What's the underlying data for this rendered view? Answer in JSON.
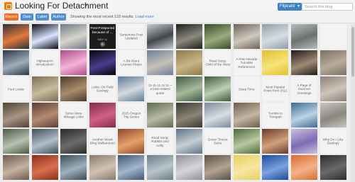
{
  "header": {
    "blog_title": "Looking For Detachment",
    "view_label": "Flipcard",
    "search_placeholder": "Search this blog"
  },
  "subbar": {
    "tabs": [
      "Recent",
      "Date",
      "Label",
      "Author"
    ],
    "showing_text": "Showing the most recent 110 results.",
    "load_more": "Load more"
  },
  "featured": {
    "title": "Post Postponed because of ...",
    "date": "MAY 11",
    "count": "0"
  },
  "grid": [
    [
      {
        "type": "img",
        "colors": [
          "#2c3038",
          "#e27a3b"
        ]
      },
      {
        "type": "img",
        "colors": [
          "#0d0d14",
          "#d9e4ff"
        ]
      },
      {
        "type": "img",
        "colors": [
          "#6f7a85",
          "#d8d4cb"
        ]
      },
      {
        "type": "featured"
      },
      {
        "type": "text",
        "caption": "Serpentine Post Updated"
      },
      {
        "type": "img",
        "colors": [
          "#c9ccd0",
          "#414649"
        ]
      },
      {
        "type": "img",
        "colors": [
          "#1e1f1c",
          "#8c8a7d"
        ]
      },
      {
        "type": "img",
        "colors": [
          "#3a4a2a",
          "#9aab7b"
        ]
      },
      {
        "type": "img",
        "colors": [
          "#6c6357",
          "#cfc9bd"
        ]
      },
      {
        "type": "img",
        "colors": [
          "#8d9faa",
          "#d7dde0"
        ]
      },
      {
        "type": "img",
        "colors": [
          "#b8bdbf",
          "#6a7270"
        ]
      },
      {
        "type": "text",
        "caption": ""
      }
    ],
    [
      {
        "type": "img",
        "colors": [
          "#2a3642",
          "#a0aebc"
        ]
      },
      {
        "type": "text",
        "caption": "Highway4A Introduction!"
      },
      {
        "type": "img",
        "colors": [
          "#b04a86",
          "#f3b4d9"
        ]
      },
      {
        "type": "img",
        "colors": [
          "#050505",
          "#4a3c8e"
        ]
      },
      {
        "type": "text",
        "caption": "A Bit About License Plates"
      },
      {
        "type": "img",
        "colors": [
          "#6d7e9b",
          "#c7c2b6"
        ]
      },
      {
        "type": "img",
        "colors": [
          "#8f7a45",
          "#c7b58a"
        ]
      },
      {
        "type": "text",
        "caption": "Road Song: Child of the West"
      },
      {
        "type": "text",
        "caption": "A Few Nevada Turnstile References"
      },
      {
        "type": "img",
        "colors": [
          "#e2c12a",
          "#f6e37b"
        ]
      },
      {
        "type": "img",
        "colors": [
          "#1f1a16",
          "#9f8a74"
        ]
      },
      {
        "type": "img",
        "colors": [
          "#7c7064",
          "#b8ab9c"
        ]
      }
    ],
    [
      {
        "type": "text",
        "caption": "Foot Loose"
      },
      {
        "type": "img",
        "colors": [
          "#7a6e55",
          "#c8bc9f"
        ]
      },
      {
        "type": "img",
        "colors": [
          "#4b3b2a",
          "#a98d6c"
        ]
      },
      {
        "type": "text",
        "caption": "Links: On Field Geology"
      },
      {
        "type": "img",
        "colors": [
          "#5c7a99",
          "#d4d9de"
        ]
      },
      {
        "type": "text",
        "caption": "11-11-11 11:11 ~ a time-related quote"
      },
      {
        "type": "img",
        "colors": [
          "#3e5a46",
          "#a8b89a"
        ]
      },
      {
        "type": "img",
        "colors": [
          "#3d5b3a",
          "#bfcfb3"
        ]
      },
      {
        "type": "text",
        "caption": "Deep Time"
      },
      {
        "type": "text",
        "caption": "Most Popular Posts from 2011"
      },
      {
        "type": "text",
        "caption": "A Page of Summer Greetings"
      },
      {
        "type": "img",
        "colors": [
          "#8b8179",
          "#cfc4b8"
        ]
      }
    ],
    [
      {
        "type": "img",
        "colors": [
          "#4e4237",
          "#a99482"
        ]
      },
      {
        "type": "img",
        "colors": [
          "#5a3d33",
          "#b48b71"
        ]
      },
      {
        "type": "text",
        "caption": "Some More Mileage Links"
      },
      {
        "type": "img",
        "colors": [
          "#7d2d47",
          "#d45f86"
        ]
      },
      {
        "type": "text",
        "caption": "2015 Oregon Trip Series"
      },
      {
        "type": "img",
        "colors": [
          "#5a6b4c",
          "#b9b8a7"
        ]
      },
      {
        "type": "img",
        "colors": [
          "#3a3a32",
          "#8a8574"
        ]
      },
      {
        "type": "img",
        "colors": [
          "#7c8a9a",
          "#d7dee4"
        ]
      },
      {
        "type": "img",
        "colors": [
          "#6a5d4e",
          "#c3b6a2"
        ]
      },
      {
        "type": "text",
        "caption": "Tumble to Tonopah"
      },
      {
        "type": "img",
        "colors": [
          "#3f6b8e",
          "#b9d3e6"
        ]
      },
      {
        "type": "img",
        "colors": [
          "#c9c6c0",
          "#8a8680"
        ]
      }
    ],
    [
      {
        "type": "img",
        "colors": [
          "#4a5848",
          "#b7c1b1"
        ]
      },
      {
        "type": "img",
        "colors": [
          "#3d4e5a",
          "#b2bec7"
        ]
      },
      {
        "type": "img",
        "colors": [
          "#2a2a2a",
          "#6b6b6b"
        ]
      },
      {
        "type": "text",
        "caption": "Another Week Blog Walkaround"
      },
      {
        "type": "img",
        "colors": [
          "#8b4a2d",
          "#e8a06a"
        ]
      },
      {
        "type": "text",
        "caption": "Road Song: Rabbits and Lefty"
      },
      {
        "type": "img",
        "colors": [
          "#5f7384",
          "#c6cfd6"
        ]
      },
      {
        "type": "text",
        "caption": "Green Timers Salve"
      },
      {
        "type": "img",
        "colors": [
          "#4d6a37",
          "#b8c8a3"
        ]
      },
      {
        "type": "img",
        "colors": [
          "#6a3b2a",
          "#d2a07c"
        ]
      },
      {
        "type": "img",
        "colors": [
          "#c9c2e0",
          "#7e6bb4"
        ]
      },
      {
        "type": "text",
        "caption": "Why Do I Like Geology"
      }
    ],
    [
      {
        "type": "img",
        "colors": [
          "#6f5b4d",
          "#c4b2a3"
        ]
      },
      {
        "type": "img",
        "colors": [
          "#8a2d1f",
          "#d9704e"
        ]
      },
      {
        "type": "img",
        "colors": [
          "#3d4a54",
          "#9eb0bd"
        ]
      },
      {
        "type": "img",
        "colors": [
          "#8b7a6a",
          "#d1c2b3"
        ]
      },
      {
        "type": "img",
        "colors": [
          "#3f5673",
          "#a2b6cc"
        ]
      },
      {
        "type": "img",
        "colors": [
          "#6c7c87",
          "#b9c5cc"
        ]
      },
      {
        "type": "img",
        "colors": [
          "#8d8f95",
          "#d6d7da"
        ]
      },
      {
        "type": "img",
        "colors": [
          "#5b5045",
          "#b0a393"
        ]
      },
      {
        "type": "img",
        "colors": [
          "#e8cf5d",
          "#f6e7a4"
        ]
      },
      {
        "type": "img",
        "colors": [
          "#1f4a9b",
          "#7aa1e0"
        ]
      },
      {
        "type": "img",
        "colors": [
          "#d96d2e",
          "#f4b28a"
        ]
      },
      {
        "type": "img",
        "colors": [
          "#2c2c2c",
          "#6a6a6a"
        ]
      }
    ]
  ]
}
